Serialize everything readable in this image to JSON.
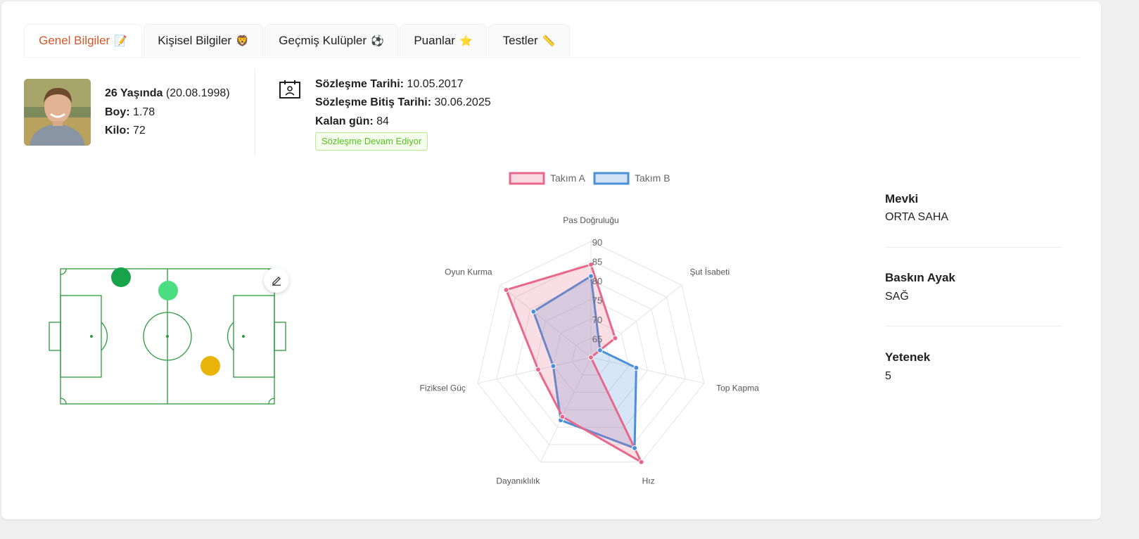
{
  "tabs": [
    {
      "label": "Genel Bilgiler",
      "icon": "📝"
    },
    {
      "label": "Kişisel Bilgiler",
      "icon": "🦁"
    },
    {
      "label": "Geçmiş Kulüpler",
      "icon": "⚽"
    },
    {
      "label": "Puanlar",
      "icon": "⭐"
    },
    {
      "label": "Testler",
      "icon": "📏"
    }
  ],
  "player": {
    "age_label": "26 Yaşında",
    "birth_date": "(20.08.1998)",
    "height_label": "Boy:",
    "height_value": "1.78",
    "weight_label": "Kilo:",
    "weight_value": "72"
  },
  "contract": {
    "start_label": "Sözleşme Tarihi:",
    "start_value": "10.05.2017",
    "end_label": "Sözleşme Bitiş Tarihi:",
    "end_value": "30.06.2025",
    "remaining_label": "Kalan gün:",
    "remaining_value": "84",
    "status": "Sözleşme Devam Ediyor"
  },
  "field": {
    "markers": [
      {
        "color": "#16a34a"
      },
      {
        "color": "#4ade80"
      },
      {
        "color": "#eab308"
      }
    ]
  },
  "chart_data": {
    "type": "radar",
    "axes": [
      "Pas Doğruluğu",
      "Şut İsabeti",
      "Top Kapma",
      "Hız",
      "Dayanıklılık",
      "Fiziksel Güç",
      "Oyun Kurma"
    ],
    "ticks": [
      "90",
      "85",
      "80",
      "75",
      "70",
      "65"
    ],
    "range": [
      60,
      90
    ],
    "series": [
      {
        "name": "Takım A",
        "color": "#e8688b",
        "values": [
          84,
          68,
          60,
          90,
          77,
          74,
          88
        ]
      },
      {
        "name": "Takım B",
        "color": "#4a8fd8",
        "values": [
          81,
          63,
          72,
          86,
          78,
          70,
          79
        ]
      }
    ]
  },
  "attributes": [
    {
      "label": "Mevki",
      "value": "ORTA SAHA"
    },
    {
      "label": "Baskın Ayak",
      "value": "SAĞ"
    },
    {
      "label": "Yetenek",
      "value": "5"
    }
  ]
}
